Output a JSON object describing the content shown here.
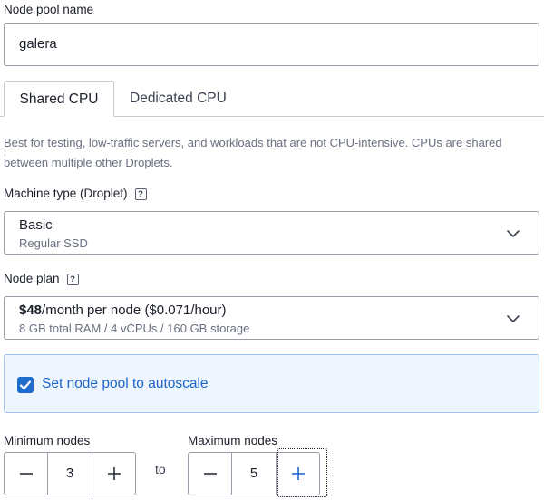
{
  "node_pool": {
    "label": "Node pool name",
    "value": "galera"
  },
  "tabs": [
    {
      "label": "Shared CPU",
      "active": true
    },
    {
      "label": "Dedicated CPU",
      "active": false
    }
  ],
  "description": "Best for testing, low-traffic servers, and workloads that are not CPU-intensive. CPUs are shared between multiple other Droplets.",
  "machine_type": {
    "label": "Machine type (Droplet)",
    "help": "?",
    "selected_main": "Basic",
    "selected_sub": "Regular SSD"
  },
  "node_plan": {
    "label": "Node plan",
    "help": "?",
    "price": "$48",
    "price_suffix": "/month per node ($0.071/hour)",
    "specs": "8 GB total RAM / 4 vCPUs / 160 GB storage"
  },
  "autoscale": {
    "label": "Set node pool to autoscale",
    "checked": true
  },
  "min_nodes": {
    "label": "Minimum nodes",
    "value": "3"
  },
  "to_label": "to",
  "max_nodes": {
    "label": "Maximum nodes",
    "value": "5"
  },
  "colors": {
    "accent": "#1f6ccf",
    "accent_bg": "#eef5fd",
    "border": "#9aa0ab",
    "muted_text": "#6a7080"
  }
}
